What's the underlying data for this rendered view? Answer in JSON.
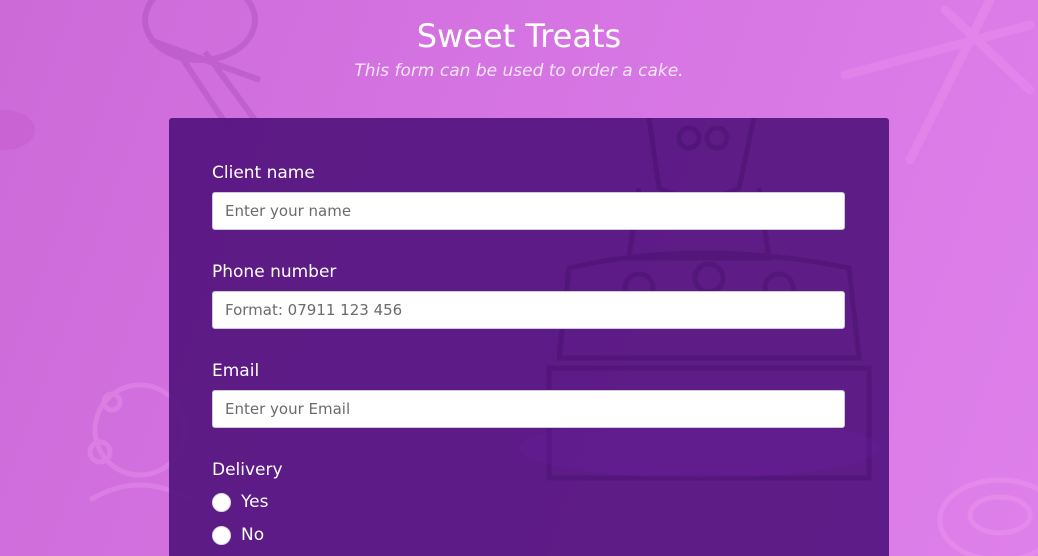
{
  "page": {
    "title": "Sweet Treats",
    "subtitle": "This form can be used to order a cake."
  },
  "form": {
    "client_name": {
      "label": "Client name",
      "placeholder": "Enter your name"
    },
    "phone": {
      "label": "Phone number",
      "placeholder": "Format: 07911 123 456"
    },
    "email": {
      "label": "Email",
      "placeholder": "Enter your Email"
    },
    "delivery": {
      "label": "Delivery",
      "options": [
        {
          "label": "Yes"
        },
        {
          "label": "No"
        }
      ]
    }
  },
  "colors": {
    "background": "#d574e2",
    "card": "#4c0f7a",
    "text": "#ffffff"
  }
}
